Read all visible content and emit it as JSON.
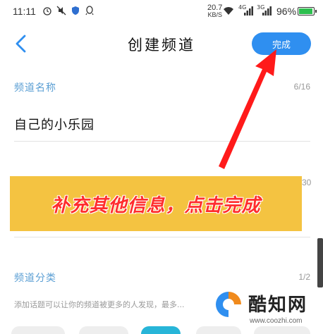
{
  "status_bar": {
    "time": "11:11",
    "net_speed_value": "20.7",
    "net_speed_unit": "KB/S",
    "signal_1": "4G",
    "signal_2": "3G",
    "battery": "96%"
  },
  "nav": {
    "title": "创建频道",
    "done_label": "完成"
  },
  "form": {
    "name_label": "频道名称",
    "name_counter": "6/16",
    "name_value": "自己的小乐园",
    "hidden_counter": "30",
    "category_label": "频道分类",
    "category_counter": "1/2",
    "hint": "添加话题可以让你的频道被更多的人发现，最多..."
  },
  "overlay": {
    "banner_text": "补充其他信息，点击完成"
  },
  "watermark": {
    "name": "酷知网",
    "url": "www.coozhi.com"
  },
  "colors": {
    "accent": "#2f8ff0",
    "label": "#5b9fd4",
    "banner_bg": "#f4c341",
    "banner_text": "#ff2d2d",
    "arrow": "#ff1a1a"
  }
}
